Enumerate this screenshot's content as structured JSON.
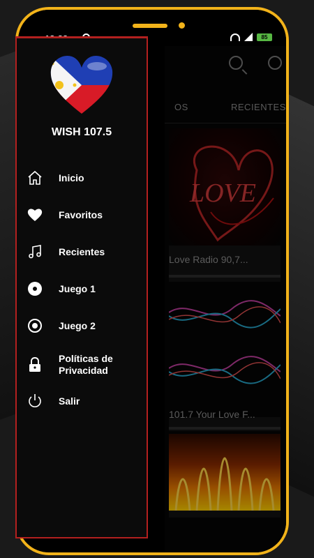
{
  "status": {
    "time": "18:33",
    "battery": "85"
  },
  "app": {
    "tabs": [
      "OS",
      "RECIENTES"
    ],
    "cards": [
      {
        "title": "Love Radio 90,7..."
      },
      {
        "title": "101.7 Your Love F..."
      }
    ]
  },
  "drawer": {
    "title": "WISH 107.5",
    "items": [
      {
        "label": "Inicio",
        "icon": "home-icon"
      },
      {
        "label": "Favoritos",
        "icon": "heart-icon"
      },
      {
        "label": "Recientes",
        "icon": "music-note-icon"
      },
      {
        "label": "Juego 1",
        "icon": "disc-icon"
      },
      {
        "label": "Juego 2",
        "icon": "target-icon"
      },
      {
        "label": "Políticas de Privacidad",
        "icon": "lock-icon"
      },
      {
        "label": "Salir",
        "icon": "power-icon"
      }
    ]
  },
  "colors": {
    "frame": "#f2b31a",
    "drawer_border": "#b3201f",
    "battery": "#57b843"
  }
}
